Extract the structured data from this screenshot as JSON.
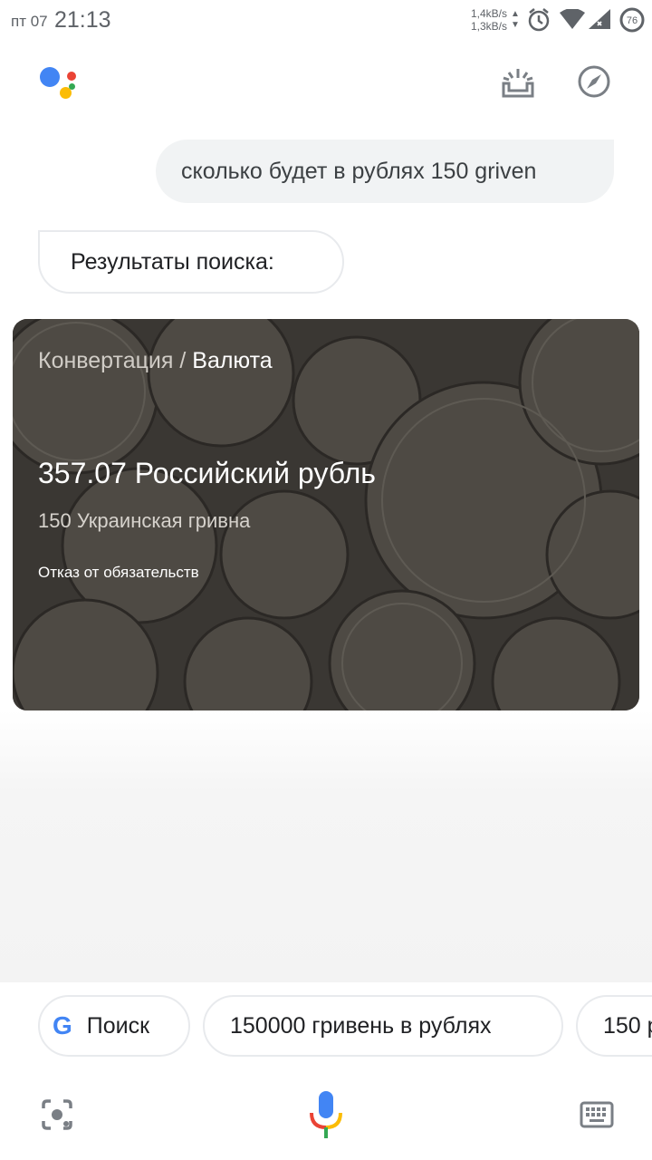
{
  "status_bar": {
    "day": "пт 07",
    "time": "21:13",
    "speed_up": "1,4kB/s",
    "speed_down": "1,3kB/s",
    "battery": "76",
    "icons": [
      "alarm-icon",
      "wifi-icon",
      "signal-icon",
      "battery-icon"
    ]
  },
  "header": {
    "logo": "google-assistant-logo",
    "left_action_icon": "snapshot-icon",
    "right_action_icon": "explore-compass-icon"
  },
  "conversation": {
    "user_query": "сколько будет в рублях 150 griven",
    "assistant_reply": "Результаты поиска:"
  },
  "currency_card": {
    "category_prefix": "Конвертация / ",
    "category_main": "Валюта",
    "result": "357.07 Российский рубль",
    "source": "150 Украинская гривна",
    "disclaimer": "Отказ от обязательств"
  },
  "suggestions": [
    {
      "label": "Поиск",
      "icon": "google-g-icon"
    },
    {
      "label": "150000 гривень в рублях"
    },
    {
      "label": "150 р"
    }
  ],
  "bottom_bar": {
    "left_icon": "lens-icon",
    "center_icon": "microphone-icon",
    "right_icon": "keyboard-icon"
  },
  "colors": {
    "google_blue": "#4285f4",
    "google_red": "#ea4335",
    "google_yellow": "#fbbc05",
    "google_green": "#34a853",
    "card_bg": "#3a3733"
  }
}
